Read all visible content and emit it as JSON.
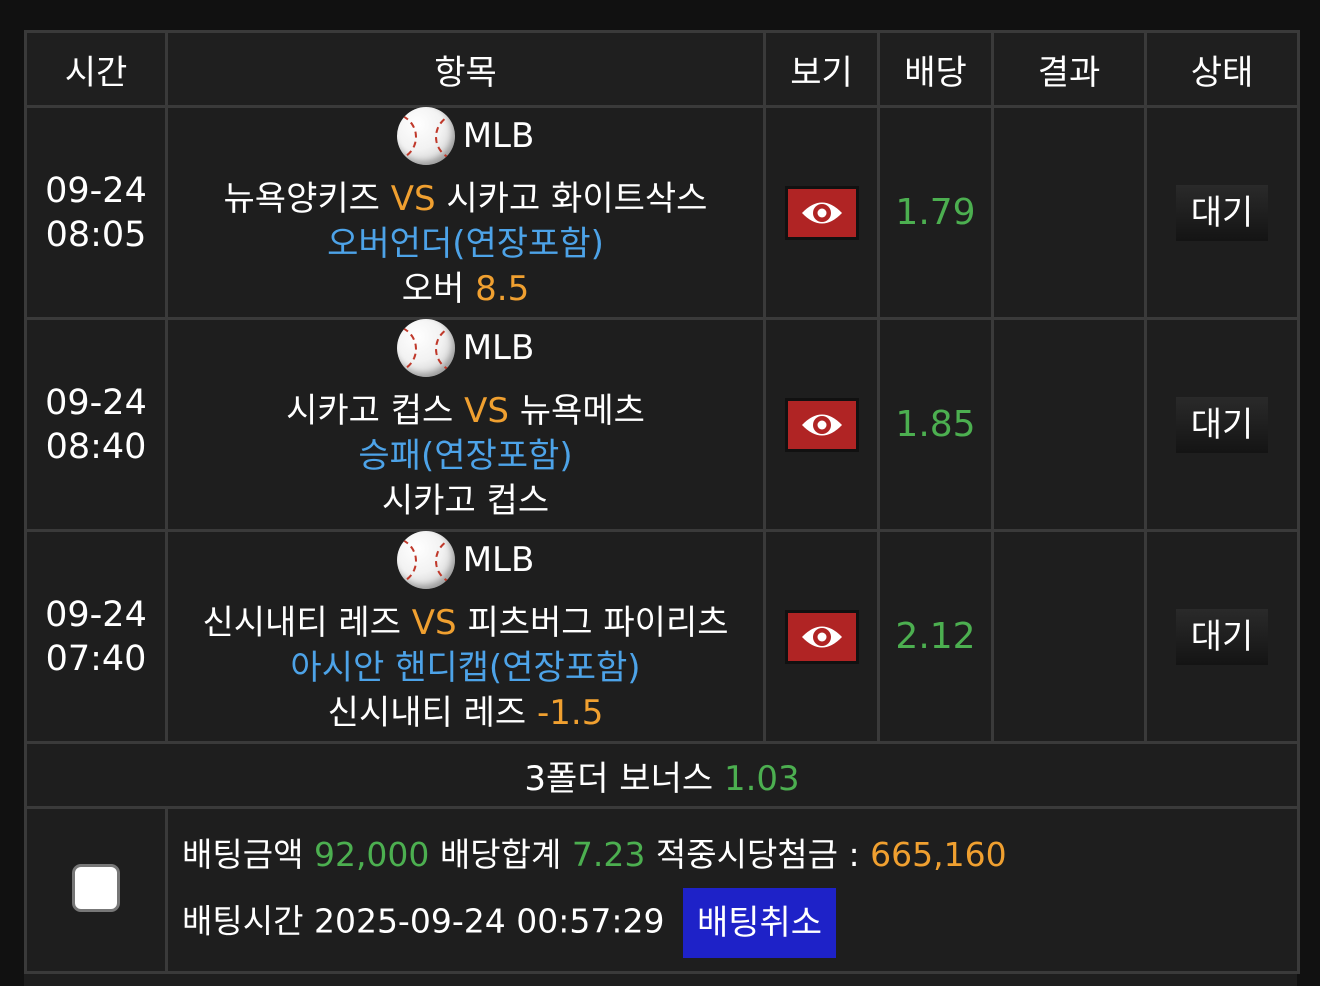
{
  "header": {
    "time": "시간",
    "item": "항목",
    "view": "보기",
    "odds": "배당",
    "result": "결과",
    "status": "상태"
  },
  "bets": [
    {
      "date": "09-24",
      "clock": "08:05",
      "league": "MLB",
      "home": "뉴욕양키즈",
      "vs": "VS",
      "away": "시카고 화이트삭스",
      "market": "오버언더(연장포함)",
      "pick_label": "오버",
      "pick_value": "8.5",
      "odds": "1.79",
      "result": "",
      "status": "대기"
    },
    {
      "date": "09-24",
      "clock": "08:40",
      "league": "MLB",
      "home": "시카고 컵스",
      "vs": "VS",
      "away": "뉴욕메츠",
      "market": "승패(연장포함)",
      "pick_label": "시카고 컵스",
      "pick_value": "",
      "odds": "1.85",
      "result": "",
      "status": "대기"
    },
    {
      "date": "09-24",
      "clock": "07:40",
      "league": "MLB",
      "home": "신시내티 레즈",
      "vs": "VS",
      "away": "피츠버그 파이리츠",
      "market": "아시안 핸디캡(연장포함)",
      "pick_label": "신시내티 레즈",
      "pick_value": "-1.5",
      "odds": "2.12",
      "result": "",
      "status": "대기"
    }
  ],
  "bonus": {
    "label": "3폴더 보너스",
    "value": "1.03"
  },
  "summary": {
    "amount_label": "배팅금액",
    "amount": "92,000",
    "total_odds_label": "배당합계",
    "total_odds": "7.23",
    "payout_label": "적중시당첨금 :",
    "payout": "665,160",
    "time_label": "배팅시간",
    "time": "2025-09-24 00:57:29",
    "cancel_label": "배팅취소"
  },
  "colors": {
    "accent_green": "#4caf50",
    "accent_orange": "#f0a030",
    "pick_blue": "#4da3e8",
    "eye_button": "#b02424",
    "cancel_button": "#1e22c8"
  },
  "icons": {
    "league": "baseball-icon",
    "view": "eye-icon"
  }
}
